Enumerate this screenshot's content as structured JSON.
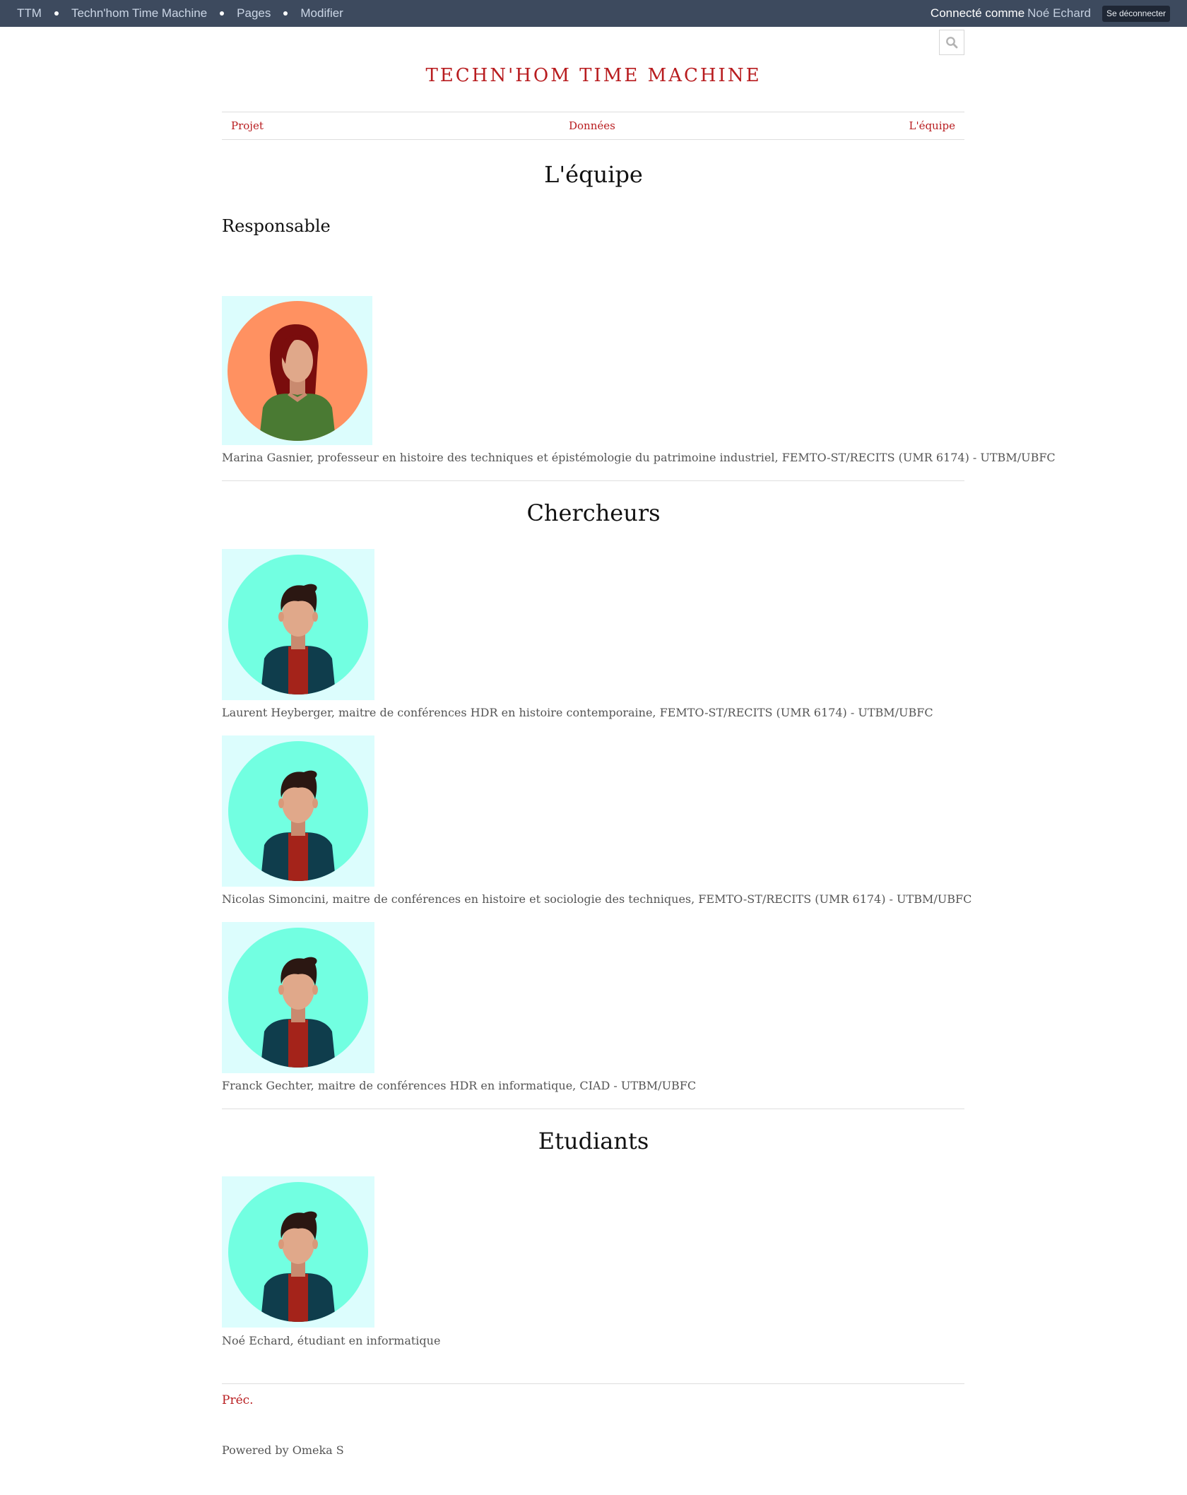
{
  "admin_bar": {
    "items": [
      "TTM",
      "Techn'hom Time Machine",
      "Pages",
      "Modifier"
    ],
    "connected_label": "Connecté comme",
    "user_name": "Noé Echard",
    "logout_label": "Se déconnecter"
  },
  "site": {
    "title": "TECHN'HOM TIME MACHINE"
  },
  "nav": {
    "items": [
      "Projet",
      "Données",
      "L'équipe"
    ]
  },
  "page": {
    "title": "L'équipe",
    "sections": {
      "responsable": {
        "heading": "Responsable",
        "members": [
          "Marina Gasnier, professeur en histoire des techniques et épistémologie du patrimoine industriel, FEMTO-ST/RECITS (UMR 6174) - UTBM/UBFC"
        ]
      },
      "chercheurs": {
        "heading": "Chercheurs",
        "members": [
          "Laurent Heyberger, maitre de conférences HDR en histoire contemporaine, FEMTO-ST/RECITS (UMR 6174) - UTBM/UBFC",
          "Nicolas Simoncini, maitre de conférences en histoire et sociologie des techniques, FEMTO-ST/RECITS (UMR 6174) - UTBM/UBFC",
          "Franck Gechter, maitre de conférences HDR en informatique, CIAD - UTBM/UBFC"
        ]
      },
      "etudiants": {
        "heading": "Etudiants",
        "members": [
          "Noé Echard, étudiant en informatique"
        ]
      }
    },
    "prev_label": "Préc.",
    "footer": "Powered by Omeka S"
  },
  "colors": {
    "accent": "#b81c1f",
    "admin_bar": "#3d4a5e",
    "avatar_bg": "#dcfdfd",
    "female_circle": "#ff9161",
    "male_circle": "#72ffe1"
  }
}
